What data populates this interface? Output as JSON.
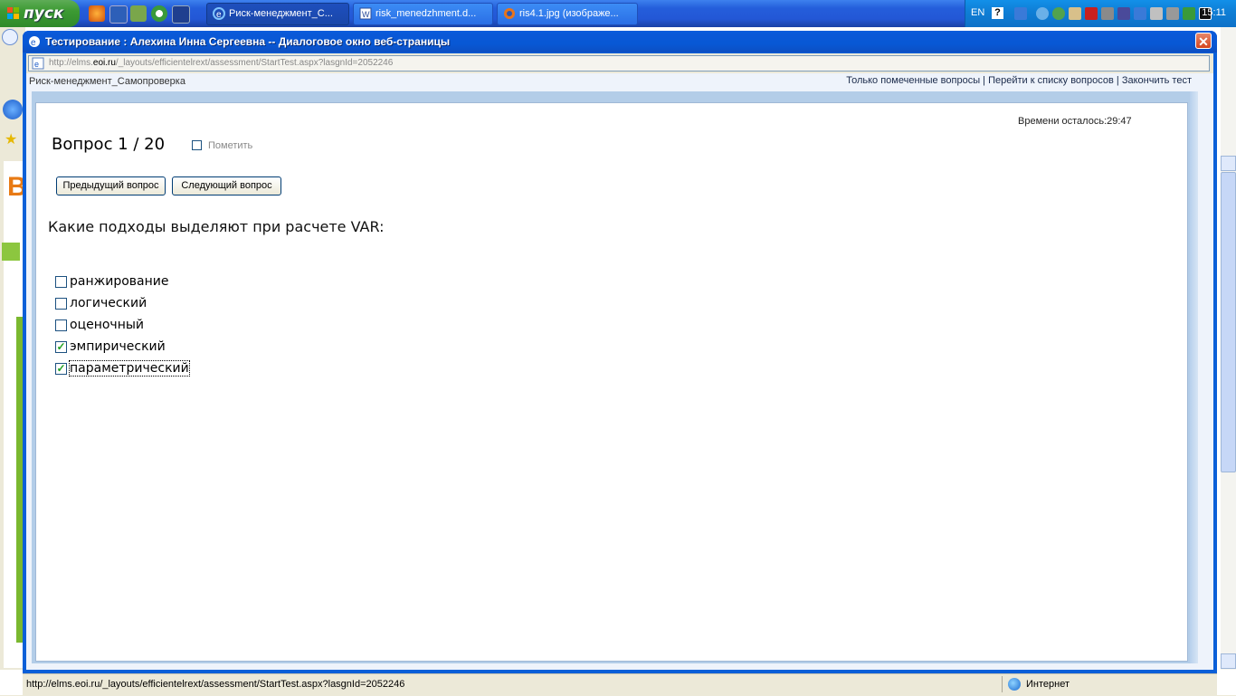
{
  "taskbar": {
    "start_label": "пуск",
    "tasks": [
      {
        "label": "Риск-менеджмент_С...",
        "active": true
      },
      {
        "label": "risk_menedzhment.d...",
        "active": false
      },
      {
        "label": "ris4.1.jpg (изображе...",
        "active": false
      }
    ],
    "lang": "EN",
    "help": "?",
    "clock": "15:11"
  },
  "dialog": {
    "title": "Тестирование : Алехина Инна Сергеевна -- Диалоговое окно веб-страницы",
    "close": "✕",
    "address_prefix": "http://elms.",
    "address_domain": "eoi.ru",
    "address_suffix": "/_layouts/efficientelrext/assessment/StartTest.aspx?lasgnId=2052246"
  },
  "page": {
    "breadcrumb": "Риск-менеджмент_Самопроверка",
    "links": {
      "marked": "Только помеченные вопросы",
      "sep1": " | ",
      "to_list": "Перейти к списку вопросов",
      "sep2": " | ",
      "finish": "Закончить тест"
    },
    "timer": "Времени осталось:29:47",
    "question_number": "Вопрос 1 / 20",
    "mark_label": "Пометить",
    "prev_button": "Предыдущий вопрос",
    "next_button": "Следующий вопрос",
    "question_text": "Какие подходы выделяют при расчете VAR:",
    "options": [
      {
        "label": "ранжирование",
        "checked": false
      },
      {
        "label": "логический",
        "checked": false
      },
      {
        "label": "оценочный",
        "checked": false
      },
      {
        "label": "эмпирический",
        "checked": true
      },
      {
        "label": "параметрический",
        "checked": true
      }
    ]
  },
  "statusbar": {
    "url": "http://elms.eoi.ru/_layouts/efficientelrext/assessment/StartTest.aspx?lasgnId=2052246",
    "zone": "Интернет"
  }
}
